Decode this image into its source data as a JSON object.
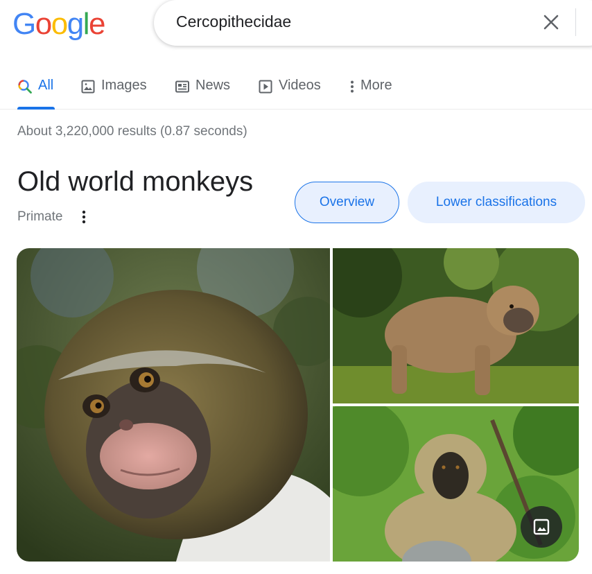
{
  "header": {
    "logo_text": [
      "G",
      "o",
      "o",
      "g",
      "l",
      "e"
    ],
    "logo_colors": [
      "#4285F4",
      "#EA4335",
      "#FBBC05",
      "#4285F4",
      "#34A853",
      "#EA4335"
    ],
    "search_query": "Cercopithecidae",
    "clear_icon": "close-icon"
  },
  "tabs": [
    {
      "label": "All",
      "icon": "search-icon",
      "active": true
    },
    {
      "label": "Images",
      "icon": "image-icon",
      "active": false
    },
    {
      "label": "News",
      "icon": "news-icon",
      "active": false
    },
    {
      "label": "Videos",
      "icon": "play-icon",
      "active": false
    },
    {
      "label": "More",
      "icon": "more-vert-icon",
      "active": false
    }
  ],
  "result_stats": "About 3,220,000 results (0.87 seconds)",
  "knowledge_panel": {
    "title": "Old world monkeys",
    "subtitle": "Primate",
    "chips": [
      {
        "label": "Overview",
        "selected": true
      },
      {
        "label": "Lower classifications",
        "selected": false
      }
    ],
    "images": [
      {
        "subject": "mona-monkey-closeup"
      },
      {
        "subject": "baboon-walking"
      },
      {
        "subject": "vervet-monkey-sitting"
      }
    ],
    "more_images_icon": "photo-icon"
  },
  "colors": {
    "accent": "#1a73e8",
    "chip_bg": "#e8f0fe",
    "muted_text": "#70757a"
  }
}
